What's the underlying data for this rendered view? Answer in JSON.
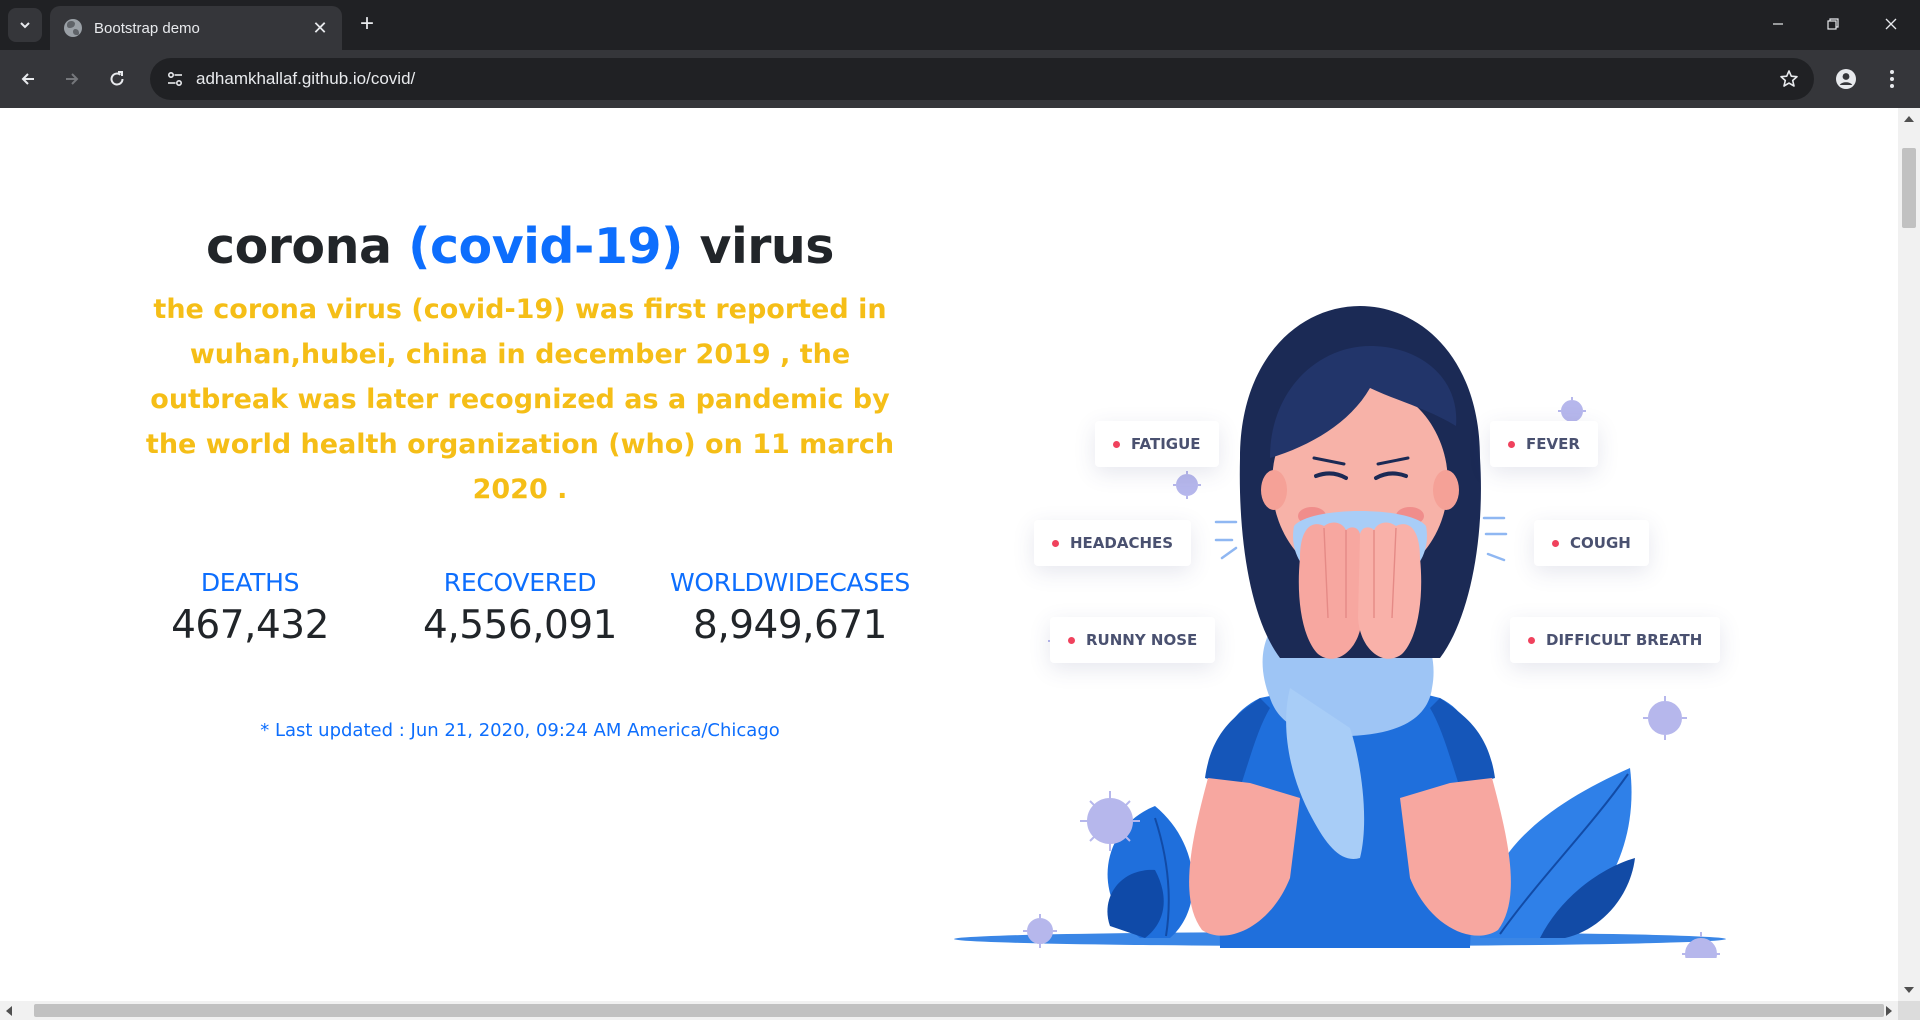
{
  "browser": {
    "tab_title": "Bootstrap demo",
    "url": "adhamkhallaf.github.io/covid/"
  },
  "page": {
    "headline": {
      "part1": "corona ",
      "accent": "(covid-19)",
      "part2": " virus"
    },
    "intro": "the corona virus (covid-19) was first reported in wuhan,hubei, china in december 2019 , the outbreak was later recognized as a pandemic by the world health organization (who) on 11 march 2020 .",
    "stats": [
      {
        "label": "DEATHS",
        "value": "467,432"
      },
      {
        "label": "RECOVERED",
        "value": "4,556,091"
      },
      {
        "label": "WORLDWIDECASES",
        "value": "8,949,671"
      }
    ],
    "updated": "* Last updated : Jun 21, 2020, 09:24 AM America/Chicago",
    "symptoms": [
      "FATIGUE",
      "HEADACHES",
      "RUNNY NOSE",
      "FEVER",
      "COUGH",
      "DIFFICULT BREATH"
    ]
  },
  "colors": {
    "accent_blue": "#0d6efd",
    "intro_yellow": "#f5be17",
    "symptom_dot": "#f0425d"
  }
}
